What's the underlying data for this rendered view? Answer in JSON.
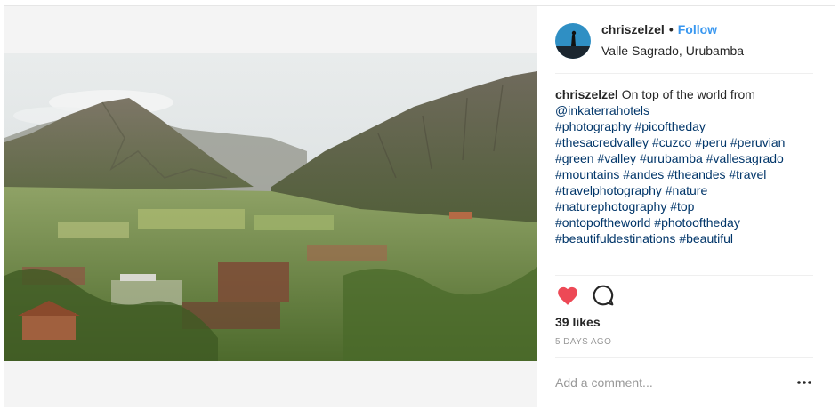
{
  "post": {
    "username": "chriszelzel",
    "separator": "•",
    "follow_label": "Follow",
    "location": "Valle Sagrado, Urubamba",
    "photo_alt": "Mountain valley view",
    "caption": {
      "username": "chriszelzel",
      "lines": [
        "On top of the world from",
        "@inkaterrahotels",
        "#photography #picoftheday",
        "#thesacredvalley #cuzco #peru #peruvian",
        "#green #valley #urubamba #vallesagrado",
        "#mountains #andes #theandes #travel",
        "#travelphotography #nature",
        "#naturephotography #top",
        "#ontopoftheworld #photooftheday",
        "#beautifuldestinations #beautiful"
      ]
    },
    "likes": "39 likes",
    "time": "5 DAYS AGO",
    "comment_placeholder": "Add a comment...",
    "icons": {
      "like": "heart-icon",
      "comment": "comment-icon",
      "more": "more-options-icon"
    },
    "colors": {
      "follow": "#3897f0",
      "heart": "#ed4956",
      "hashtag": "#003569"
    }
  }
}
